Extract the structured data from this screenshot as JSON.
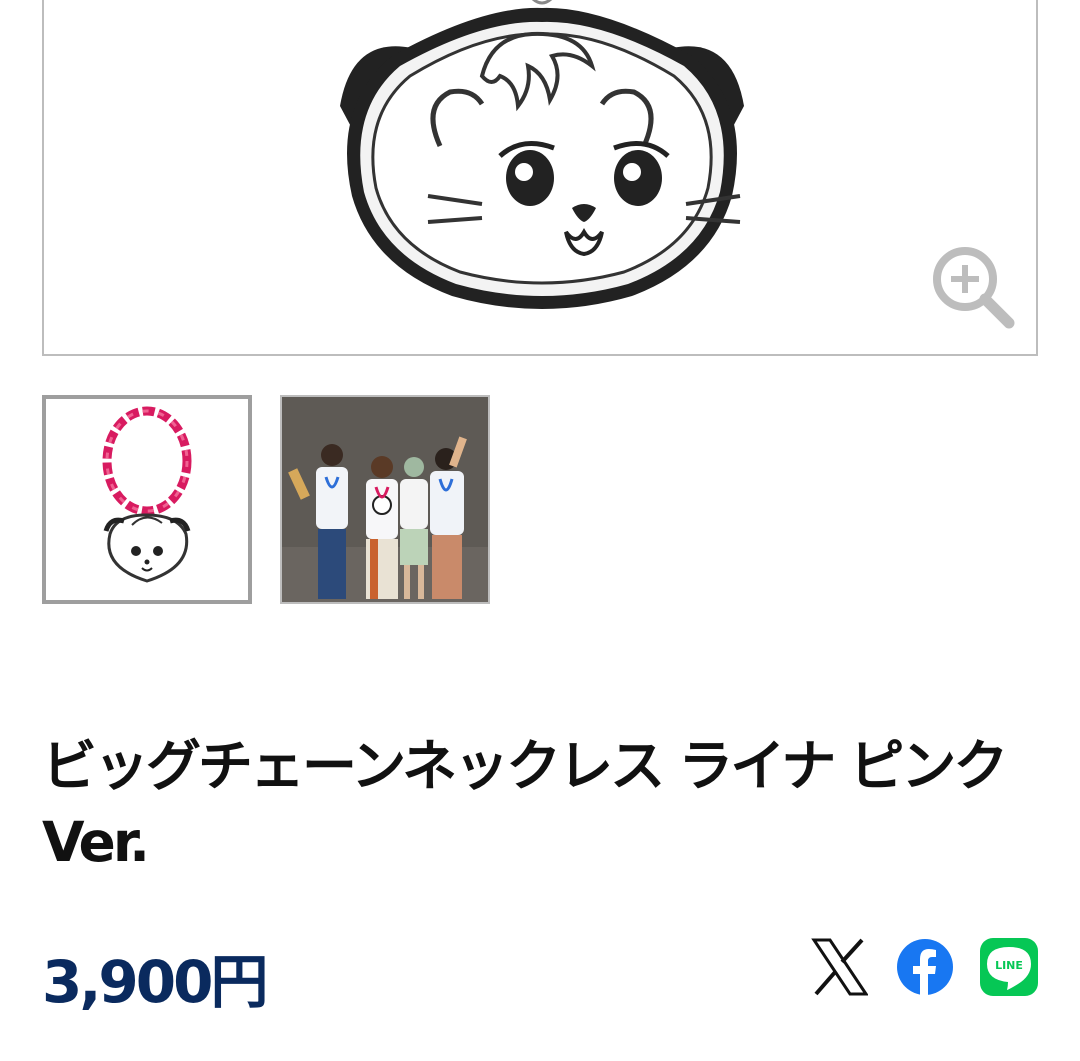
{
  "product": {
    "title_line1": "ビッグチェーンネックレス ライナ ピンク",
    "title_line2": "Ver.",
    "price": "3,900円"
  },
  "gallery": {
    "thumbnails": [
      {
        "alt": "ネックレス全体"
      },
      {
        "alt": "着用イメージ"
      }
    ]
  },
  "share": {
    "x_label": "X",
    "facebook_label": "Facebook",
    "line_label": "LINE"
  },
  "colors": {
    "price": "#0a2a5e",
    "chain_pink": "#d81b60",
    "line_green": "#06c755",
    "facebook_blue": "#1877f2"
  }
}
